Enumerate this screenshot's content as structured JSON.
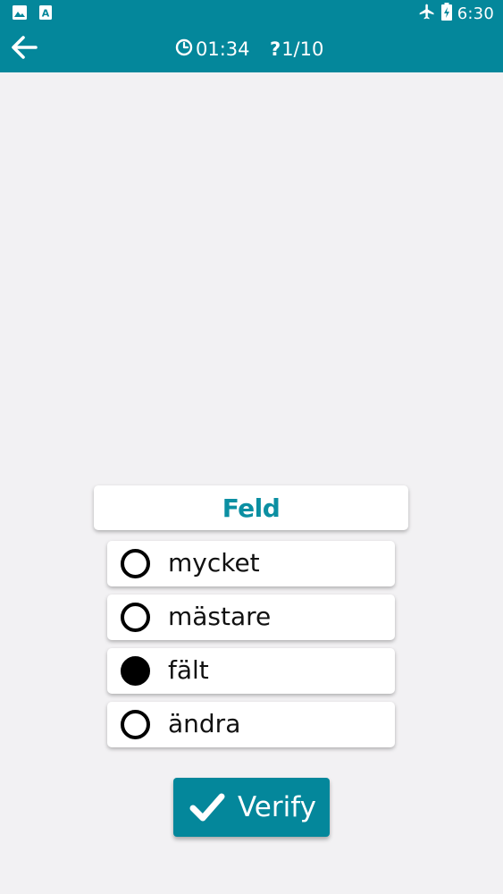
{
  "status_bar": {
    "time": "6:30",
    "icons": [
      "image-icon",
      "text-a-icon",
      "airplane-icon",
      "battery-charging-icon"
    ]
  },
  "app_bar": {
    "back_icon": "arrow-left-icon",
    "timer": "01:34",
    "timer_icon": "clock-icon",
    "question_icon": "question-mark-icon",
    "counter": "1/10"
  },
  "quiz": {
    "word": "Feld",
    "options": [
      {
        "label": "mycket",
        "selected": false
      },
      {
        "label": "mästare",
        "selected": false
      },
      {
        "label": "fält",
        "selected": true
      },
      {
        "label": "ändra",
        "selected": false
      }
    ]
  },
  "verify": {
    "label": "Verify",
    "icon": "checkmark-icon"
  },
  "colors": {
    "primary": "#04879b",
    "word": "#0b8fa2",
    "background": "#f2f1f3"
  }
}
